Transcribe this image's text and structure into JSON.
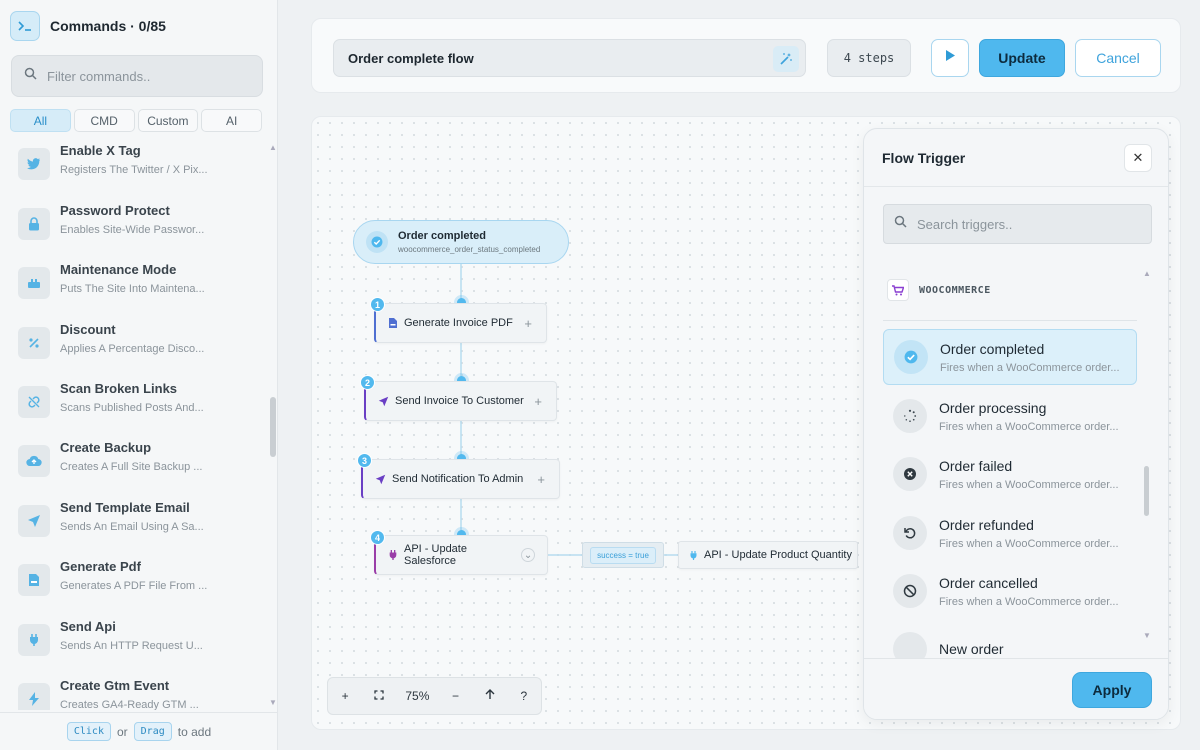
{
  "sidebar": {
    "title": "Commands · 0/85",
    "filter_placeholder": "Filter commands..",
    "tabs": [
      "All",
      "CMD",
      "Custom",
      "AI"
    ],
    "active_tab": "All",
    "commands": [
      {
        "name": "Enable X Tag",
        "desc": "Registers The Twitter / X Pix...",
        "icon": "twitter-icon"
      },
      {
        "name": "Password Protect",
        "desc": "Enables Site-Wide Passwor...",
        "icon": "lock-icon"
      },
      {
        "name": "Maintenance Mode",
        "desc": "Puts The Site Into Maintena...",
        "icon": "maintenance-icon"
      },
      {
        "name": "Discount",
        "desc": "Applies A Percentage Disco...",
        "icon": "percent-icon"
      },
      {
        "name": "Scan Broken Links",
        "desc": "Scans Published Posts And...",
        "icon": "broken-link-icon"
      },
      {
        "name": "Create Backup",
        "desc": "Creates A Full Site Backup ...",
        "icon": "cloud-upload-icon"
      },
      {
        "name": "Send Template Email",
        "desc": "Sends An Email Using A Sa...",
        "icon": "send-icon"
      },
      {
        "name": "Generate Pdf",
        "desc": "Generates A PDF File From ...",
        "icon": "pdf-icon"
      },
      {
        "name": "Send Api",
        "desc": "Sends An HTTP Request U...",
        "icon": "plug-icon"
      },
      {
        "name": "Create Gtm Event",
        "desc": "Creates GA4-Ready GTM ...",
        "icon": "bolt-icon"
      }
    ],
    "footer": {
      "click": "Click",
      "or": "or",
      "drag": "Drag",
      "to_add": "to add"
    }
  },
  "toolbar": {
    "flow_name": "Order complete flow",
    "steps": "4 steps",
    "update_label": "Update",
    "cancel_label": "Cancel"
  },
  "canvas": {
    "trigger": {
      "title": "Order completed",
      "event": "woocommerce_order_status_completed"
    },
    "steps": [
      {
        "num": "1",
        "label": "Generate Invoice PDF"
      },
      {
        "num": "2",
        "label": "Send Invoice To Customer"
      },
      {
        "num": "3",
        "label": "Send Notification To Admin"
      },
      {
        "num": "4",
        "label": "API - Update Salesforce"
      }
    ],
    "condition": "success = true",
    "branch_step": "API - Update Product Quantity",
    "zoom": "75%",
    "help": "?"
  },
  "trigger_panel": {
    "title": "Flow Trigger",
    "search_placeholder": "Search triggers..",
    "group": "WOOCOMMERCE",
    "triggers": [
      {
        "name": "Order completed",
        "desc": "Fires when a WooCommerce order...",
        "icon": "check-circle-icon",
        "selected": true
      },
      {
        "name": "Order processing",
        "desc": "Fires when a WooCommerce order...",
        "icon": "spinner-icon"
      },
      {
        "name": "Order failed",
        "desc": "Fires when a WooCommerce order...",
        "icon": "x-circle-icon"
      },
      {
        "name": "Order refunded",
        "desc": "Fires when a WooCommerce order...",
        "icon": "undo-icon"
      },
      {
        "name": "Order cancelled",
        "desc": "Fires when a WooCommerce order...",
        "icon": "ban-icon"
      },
      {
        "name": "New order",
        "desc": "",
        "icon": "cart-icon"
      }
    ],
    "apply_label": "Apply"
  },
  "colors": {
    "accent": "#4fb8ee",
    "purple": "#6a3fc4"
  }
}
